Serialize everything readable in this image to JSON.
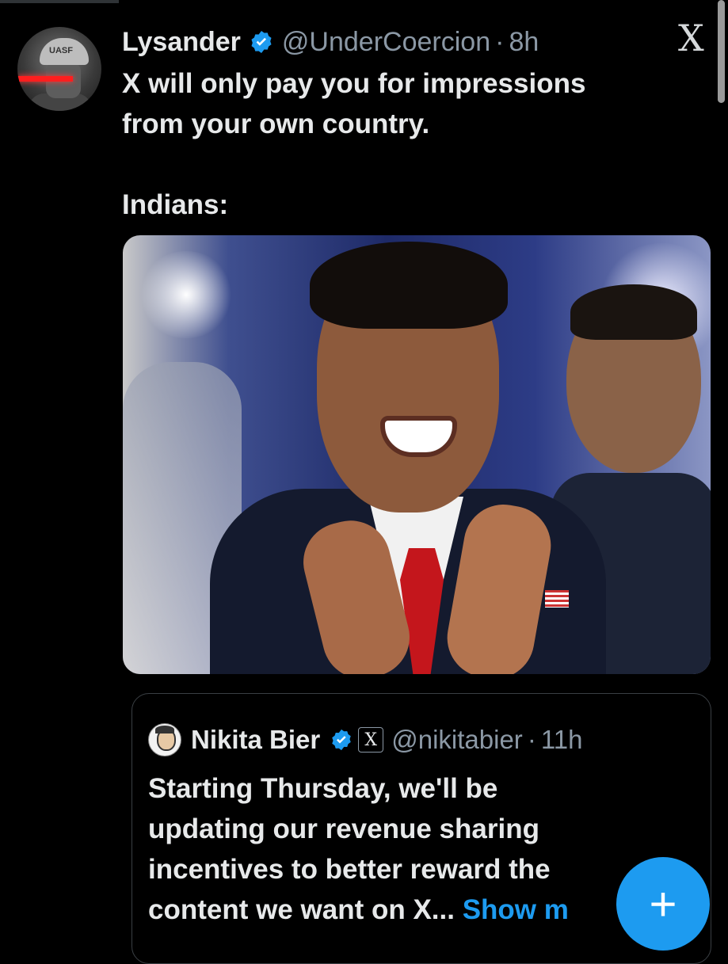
{
  "tweet": {
    "author_name": "Lysander",
    "author_handle": "@UnderCoercion",
    "separator": "·",
    "timestamp": "8h",
    "avatar_helmet_text": "UASF",
    "text_lines": [
      "X will only pay you for impressions",
      "from your own country."
    ],
    "text_second_paragraph": "Indians:"
  },
  "platform_logo": "X",
  "quoted_tweet": {
    "author_name": "Nikita Bier",
    "badge_label": "X",
    "author_handle": "@nikitabier",
    "separator": "·",
    "timestamp": "11h",
    "text_lines": [
      "Starting Thursday, we'll be",
      "updating our revenue sharing",
      "incentives to better reward the",
      "content we want on X..."
    ],
    "show_more_label": "Show m"
  },
  "fab": {
    "label": "+"
  },
  "colors": {
    "background": "#000000",
    "accent": "#1d9bf0",
    "muted": "#8b98a5",
    "text": "#e7e9ea"
  },
  "icons": [
    "verified-badge-icon",
    "x-logo-icon",
    "compose-plus-icon"
  ]
}
